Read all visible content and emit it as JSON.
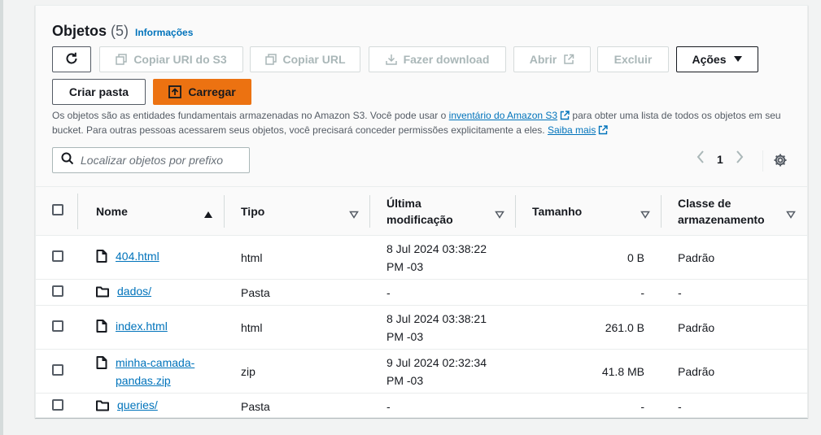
{
  "header": {
    "title": "Objetos",
    "count": "(5)",
    "info_link": "Informações"
  },
  "toolbar": {
    "copy_uri": "Copiar URI do S3",
    "copy_url": "Copiar URL",
    "download": "Fazer download",
    "open": "Abrir",
    "delete": "Excluir",
    "actions": "Ações",
    "create_folder": "Criar pasta",
    "upload": "Carregar"
  },
  "description": {
    "part1": "Os objetos são as entidades fundamentais armazenadas no Amazon S3. Você pode usar o ",
    "inventory_link": "inventário do Amazon S3",
    "part2": " para obter uma lista de todos os objetos em seu bucket. Para outras pessoas acessarem seus objetos, você precisará conceder permissões explicitamente a eles. ",
    "learn_more_link": "Saiba mais"
  },
  "search": {
    "placeholder": "Localizar objetos por prefixo"
  },
  "pagination": {
    "current_page": "1"
  },
  "table": {
    "columns": {
      "name": "Nome",
      "type": "Tipo",
      "modified_line1": "Última",
      "modified_line2": "modificação",
      "size": "Tamanho",
      "storage_line1": "Classe de",
      "storage_line2": "armazenamento"
    },
    "rows": [
      {
        "icon": "file-icon",
        "name_line1": "404.html",
        "name_line2": "",
        "type": "html",
        "mod_line1": "8 Jul 2024 03:38:22",
        "mod_line2": "PM -03",
        "size": "0 B",
        "storage": "Padrão"
      },
      {
        "icon": "folder-icon",
        "name_line1": "dados/",
        "name_line2": "",
        "type": "Pasta",
        "mod_line1": "-",
        "mod_line2": "",
        "size": "-",
        "storage": "-"
      },
      {
        "icon": "file-icon",
        "name_line1": "index.html",
        "name_line2": "",
        "type": "html",
        "mod_line1": "8 Jul 2024 03:38:21",
        "mod_line2": "PM -03",
        "size": "261.0 B",
        "storage": "Padrão"
      },
      {
        "icon": "file-icon",
        "name_line1": "minha-camada-",
        "name_line2": "pandas.zip",
        "type": "zip",
        "mod_line1": "9 Jul 2024 02:32:34",
        "mod_line2": "PM -03",
        "size": "41.8 MB",
        "storage": "Padrão"
      },
      {
        "icon": "folder-icon",
        "name_line1": "queries/",
        "name_line2": "",
        "type": "Pasta",
        "mod_line1": "-",
        "mod_line2": "",
        "size": "-",
        "storage": "-"
      }
    ]
  },
  "colors": {
    "accent_link": "#0073bb",
    "primary_button": "#ec7211",
    "text": "#16191f"
  }
}
